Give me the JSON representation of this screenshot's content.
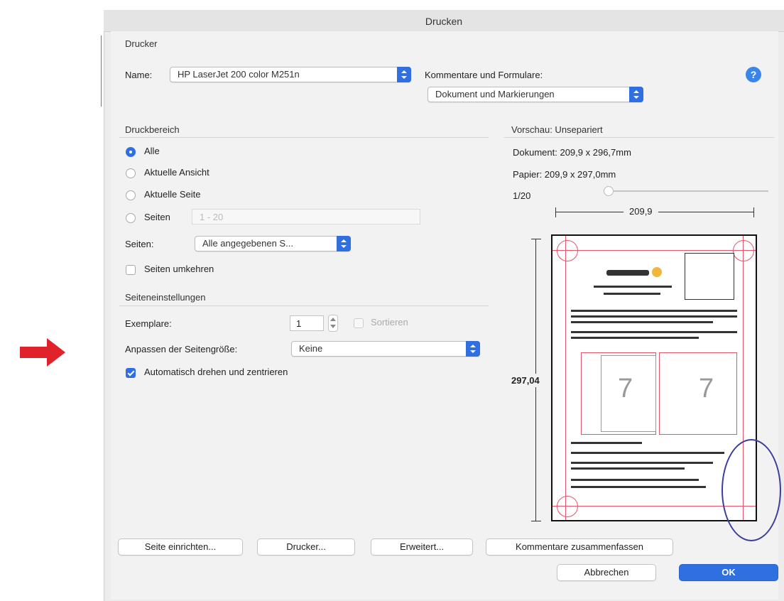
{
  "window": {
    "title": "Drucken"
  },
  "printer": {
    "section_title": "Drucker",
    "name_label": "Name:",
    "name_value": "HP LaserJet 200 color M251n",
    "comments_label": "Kommentare und Formulare:",
    "comments_value": "Dokument und Markierungen",
    "help_icon": "?"
  },
  "range": {
    "section_title": "Druckbereich",
    "options": [
      "Alle",
      "Aktuelle Ansicht",
      "Aktuelle Seite",
      "Seiten"
    ],
    "selected": "Alle",
    "pages_field_value": "1 - 20",
    "subset_label": "Seiten:",
    "subset_value": "Alle angegebenen S...",
    "reverse_label": "Seiten umkehren"
  },
  "setup": {
    "section_title": "Seiteneinstellungen",
    "copies_label": "Exemplare:",
    "copies_value": "1",
    "collate_label": "Sortieren",
    "scaling_label": "Anpassen der Seitengröße:",
    "scaling_value": "Keine",
    "autorotate_label": "Automatisch drehen und zentrieren",
    "autorotate_checked": true
  },
  "preview": {
    "section_title": "Vorschau: Unsepariert",
    "document": "Dokument: 209,9 x 296,7mm",
    "paper": "Papier: 209,9 x 297,0mm",
    "page_indicator": "1/20",
    "width_label": "209,9",
    "height_label": "297,04",
    "page_numbers": [
      "7",
      "7"
    ]
  },
  "buttons": {
    "page_setup": "Seite einrichten...",
    "printer": "Drucker...",
    "advanced": "Erweitert...",
    "summarize": "Kommentare zusammenfassen",
    "cancel": "Abbrechen",
    "ok": "OK"
  },
  "colors": {
    "accent": "#2f6fe0",
    "arrow": "#e0222a",
    "bleed": "#e5556a"
  }
}
